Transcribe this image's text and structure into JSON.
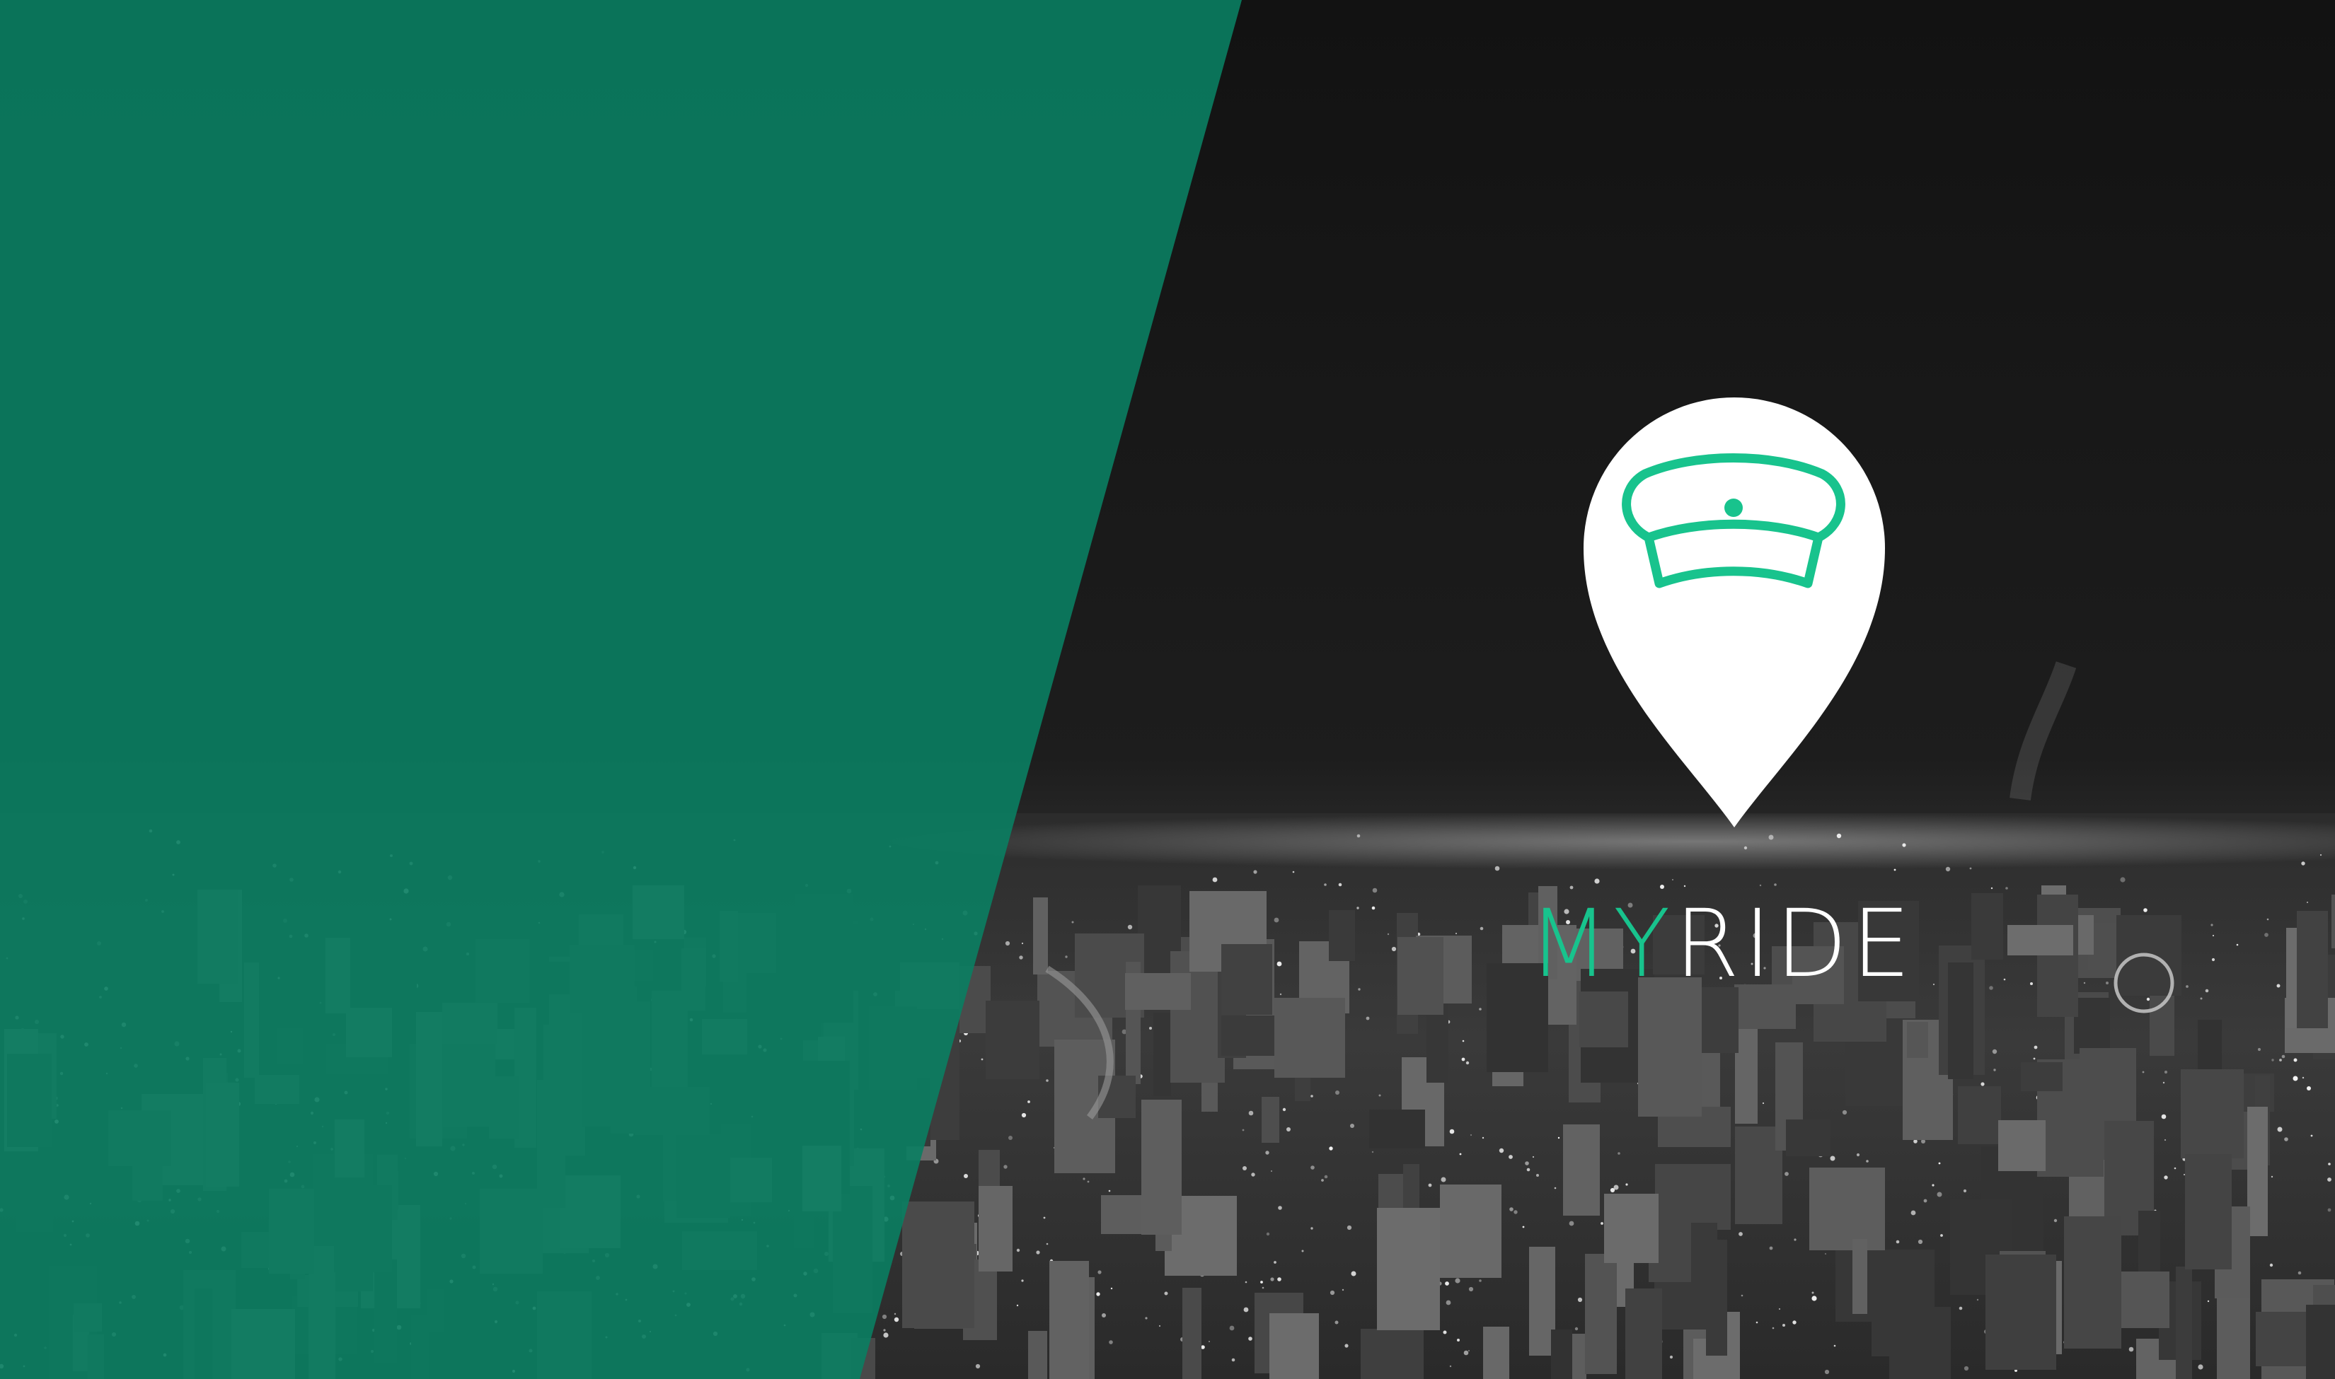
{
  "brand": {
    "name_part_1": "MY",
    "name_part_2": "RIDE",
    "logo_icon": "location-pin-with-chauffeur-cap-icon"
  },
  "colors": {
    "accent": "#18c38d",
    "green_panel": "#0a7e62",
    "night_sky": "#151515",
    "pin_fill": "#ffffff"
  },
  "background": {
    "scene": "city-at-night-photo",
    "overlay": "diagonal-green-panel-left"
  }
}
